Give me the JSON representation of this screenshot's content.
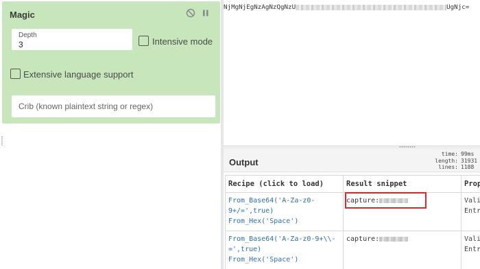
{
  "operation": {
    "title": "Magic",
    "depth_label": "Depth",
    "depth_value": "3",
    "intensive_mode_label": "Intensive mode",
    "extensive_language_label": "Extensive language support",
    "crib_placeholder": "Crib (known plaintext string or regex)",
    "icons": [
      "disable-icon",
      "pause-icon"
    ]
  },
  "input": {
    "text_start": "NjMgNjEgNzAgNzQgNzU",
    "text_end": "UgNjc="
  },
  "output": {
    "title": "Output",
    "stats": [
      {
        "key": "time:",
        "value": "99ms"
      },
      {
        "key": "length:",
        "value": "31931"
      },
      {
        "key": "lines:",
        "value": "1188"
      }
    ],
    "table": {
      "headers": [
        "Recipe (click to load)",
        "Result snippet",
        "Prop"
      ],
      "rows": [
        {
          "recipe": [
            "From_Base64('A-Za-z0-",
            "9+/=',true)",
            "From_Hex('Space')"
          ],
          "snippet": "capture:",
          "props": [
            "Vali",
            "Entr"
          ]
        },
        {
          "recipe": [
            "From_Base64('A-Za-z0-9+\\\\-",
            "=',true)",
            "From_Hex('Space')"
          ],
          "snippet": "capture:",
          "props": [
            "Vali",
            "Entr"
          ]
        }
      ]
    }
  },
  "colors": {
    "operation_bg": "#c8e6bb",
    "recipe_link": "#2a6fb3",
    "highlight": "#e0262b"
  }
}
